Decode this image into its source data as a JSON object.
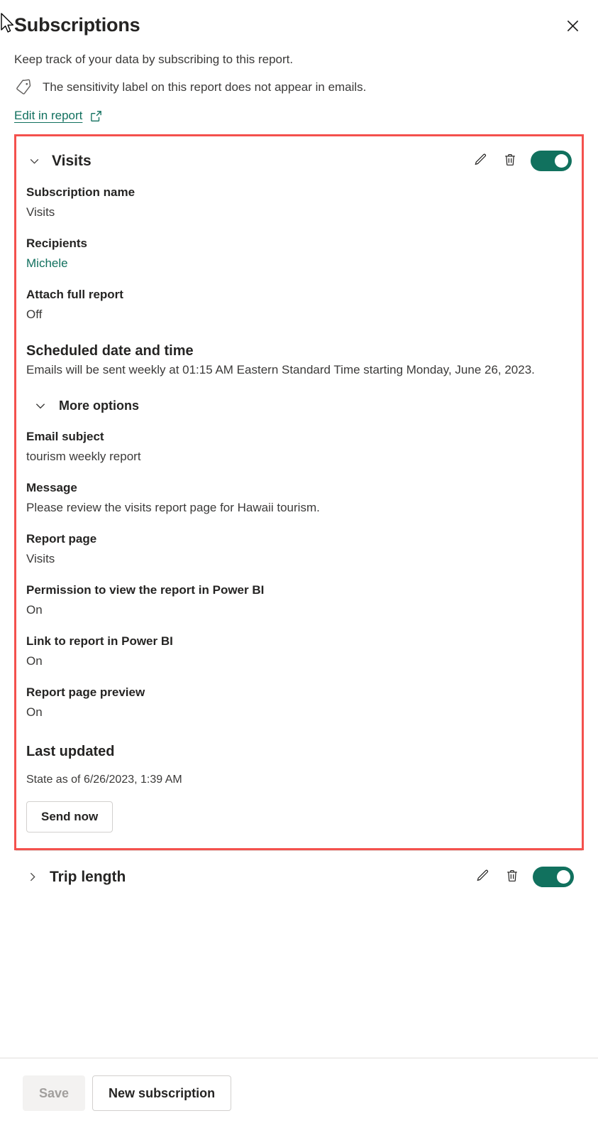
{
  "header": {
    "title": "Subscriptions",
    "close_icon": "close-icon",
    "subtitle": "Keep track of your data by subscribing to this report.",
    "sensitivity_icon": "tag-icon",
    "sensitivity_text": "The sensitivity label on this report does not appear in emails.",
    "edit_link": "Edit in report",
    "external_link_icon": "external-link-icon"
  },
  "colors": {
    "accent_teal": "#11715e",
    "link_teal": "#11705e",
    "highlight_red": "#f4514d",
    "text_primary": "#252423",
    "text_secondary": "#3b3a39",
    "disabled_text": "#a19f9d"
  },
  "subscriptions": [
    {
      "name": "Visits",
      "expanded": true,
      "chevron_icon": "chevron-down-icon",
      "edit_icon": "pencil-icon",
      "delete_icon": "trash-icon",
      "toggle_state": "On",
      "fields": [
        {
          "label": "Subscription name",
          "value": "Visits",
          "style": "normal"
        },
        {
          "label": "Recipients",
          "value": "Michele",
          "style": "link"
        },
        {
          "label": "Attach full report",
          "value": "Off",
          "style": "normal"
        },
        {
          "label": "Scheduled date and time",
          "value": "Emails will be sent weekly at 01:15 AM Eastern Standard Time starting Monday, June 26, 2023.",
          "style": "big"
        }
      ],
      "more_options": {
        "label": "More options",
        "chevron_icon": "chevron-down-icon",
        "expanded": true,
        "fields": [
          {
            "label": "Email subject",
            "value": "tourism weekly report"
          },
          {
            "label": "Message",
            "value": "Please review the visits report page for Hawaii tourism."
          },
          {
            "label": "Report page",
            "value": "Visits"
          },
          {
            "label": "Permission to view the report in Power BI",
            "value": "On"
          },
          {
            "label": "Link to report in Power BI",
            "value": "On"
          },
          {
            "label": "Report page preview",
            "value": "On"
          }
        ]
      },
      "last_updated": {
        "label": "Last updated",
        "state": "State as of 6/26/2023, 1:39 AM",
        "send_now_label": "Send now"
      }
    },
    {
      "name": "Trip length",
      "expanded": false,
      "chevron_icon": "chevron-right-icon",
      "edit_icon": "pencil-icon",
      "delete_icon": "trash-icon",
      "toggle_state": "On"
    }
  ],
  "footer": {
    "save_label": "Save",
    "save_disabled": true,
    "new_subscription_label": "New subscription"
  }
}
